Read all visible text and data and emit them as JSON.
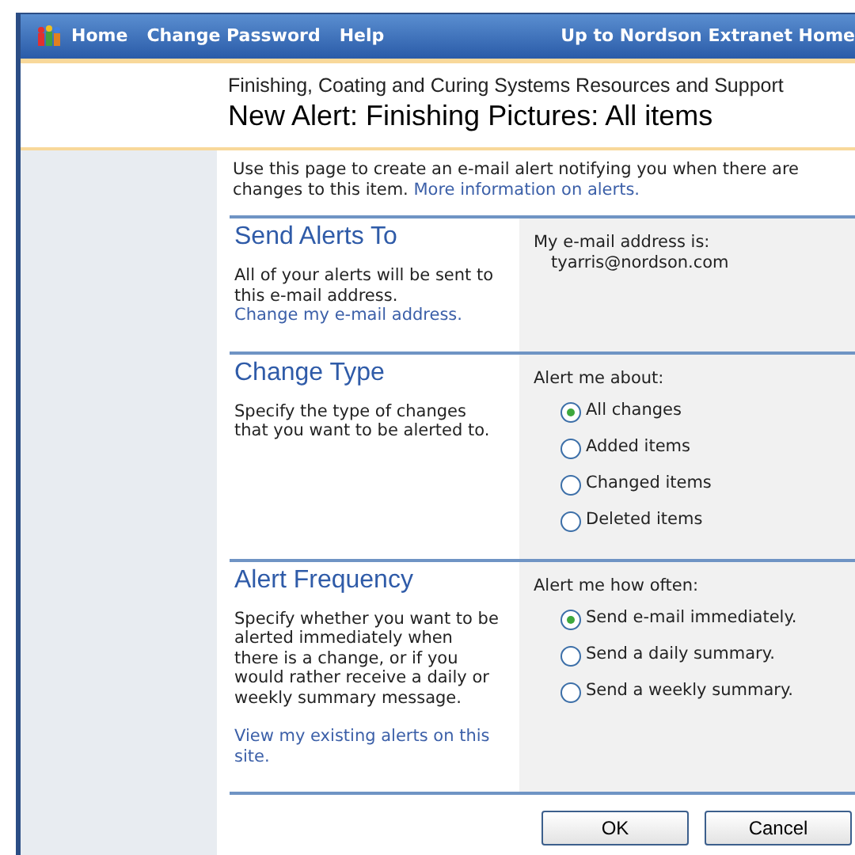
{
  "top_nav": {
    "links": [
      "Home",
      "Change Password",
      "Help"
    ],
    "right_link": "Up to Nordson Extranet Home"
  },
  "header": {
    "site_title": "Finishing, Coating and Curing Systems Resources and Support",
    "page_title": "New Alert: Finishing Pictures: All items"
  },
  "intro": {
    "text": "Use this page to create an e-mail alert notifying you when there are changes to this item.",
    "link": "More information on alerts."
  },
  "sections": [
    {
      "kind": "email",
      "title": "Send Alerts To",
      "description": "All of your alerts will be sent to this e-mail address.",
      "link": "Change my e-mail address.",
      "prompt": "My e-mail address is:",
      "value": "tyarris@nordson.com"
    },
    {
      "kind": "radio",
      "title": "Change Type",
      "description": "Specify the type of changes that you want to be alerted to.",
      "prompt": "Alert me about:",
      "options": [
        {
          "label": "All changes",
          "selected": true
        },
        {
          "label": "Added items",
          "selected": false
        },
        {
          "label": "Changed items",
          "selected": false
        },
        {
          "label": "Deleted items",
          "selected": false
        }
      ]
    },
    {
      "kind": "radio",
      "title": "Alert Frequency",
      "description": "Specify whether you want to be alerted immediately when there is a change, or if you would rather receive a daily or weekly summary message.",
      "extra_link": "View my existing alerts on this site.",
      "prompt": "Alert me how often:",
      "options": [
        {
          "label": "Send e-mail immediately.",
          "selected": true
        },
        {
          "label": "Send a daily summary.",
          "selected": false
        },
        {
          "label": "Send a weekly summary.",
          "selected": false
        }
      ]
    }
  ],
  "buttons": [
    "OK",
    "Cancel"
  ]
}
